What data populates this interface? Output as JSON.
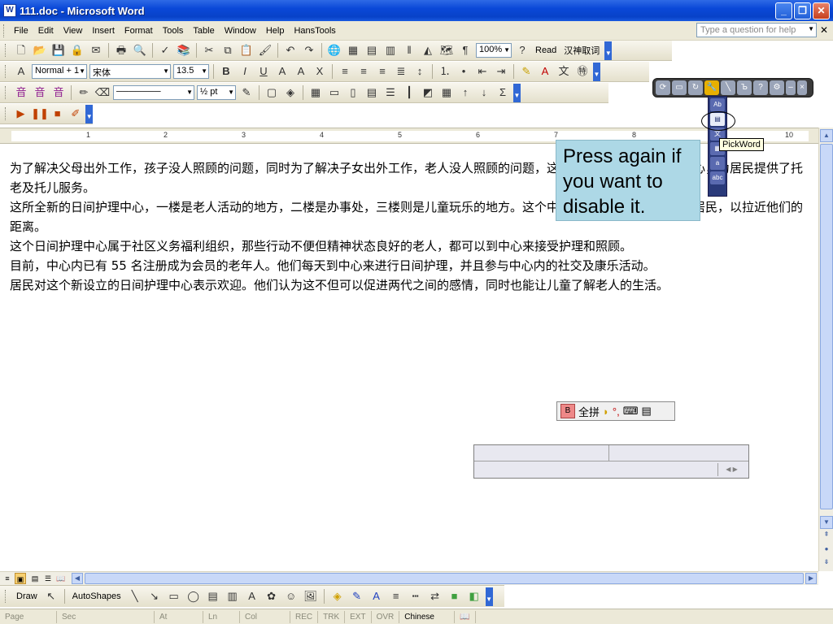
{
  "window": {
    "title": "111.doc - Microsoft Word",
    "app_icon": "W",
    "minimize": "_",
    "maximize": "❐",
    "close": "✕"
  },
  "menu": {
    "items": [
      "File",
      "Edit",
      "View",
      "Insert",
      "Format",
      "Tools",
      "Table",
      "Window",
      "Help",
      "HansTools"
    ],
    "help_placeholder": "Type a question for help",
    "doc_close": "✕"
  },
  "standard_toolbar": {
    "zoom": "100%",
    "read_label": "Read",
    "translate_label": "汉神取词"
  },
  "formatting_toolbar": {
    "style": "Normal + 1",
    "font": "宋体",
    "size": "13.5"
  },
  "tables_toolbar": {
    "line_weight": "½ pt"
  },
  "ruler": {
    "numbers": [
      "1",
      "2",
      "3",
      "4",
      "5",
      "6",
      "7",
      "8",
      "9",
      "10"
    ]
  },
  "document": {
    "paragraphs": [
      "为了解决父母出外工作，孩子没人照顾的问题，同时为了解决子女出外工作，老人没人照顾的问题，这个社区开设了日间护理中心，为居民提供了托老及托儿服务。",
      "这所全新的日间护理中心，一楼是老人活动的地方，二楼是办事处，三楼则是儿童玩乐的地方。这个中心的特色就是结合了老幼居民，以拉近他们的距离。",
      "这个日间护理中心属于社区义务福利组织，那些行动不便但精神状态良好的老人，都可以到中心来接受护理和照顾。",
      "目前，中心内已有 55 名注册成为会员的老年人。他们每天到中心来进行日间护理，并且参与中心内的社交及康乐活动。",
      "居民对这个新设立的日间护理中心表示欢迎。他们认为这不但可以促进两代之间的感情，同时也能让儿童了解老人的生活。"
    ]
  },
  "callout": {
    "text": "Press again if you want to disable it."
  },
  "tooltip": {
    "text": "PickWord"
  },
  "ime": {
    "label": "全拼",
    "punct": "°,"
  },
  "drawing_toolbar": {
    "draw": "Draw",
    "autoshapes": "AutoShapes"
  },
  "statusbar": {
    "page": "Page",
    "sec": "Sec",
    "at": "At",
    "ln": "Ln",
    "col": "Col",
    "rec": "REC",
    "trk": "TRK",
    "ext": "EXT",
    "ovr": "OVR",
    "language": "Chinese (PR"
  }
}
